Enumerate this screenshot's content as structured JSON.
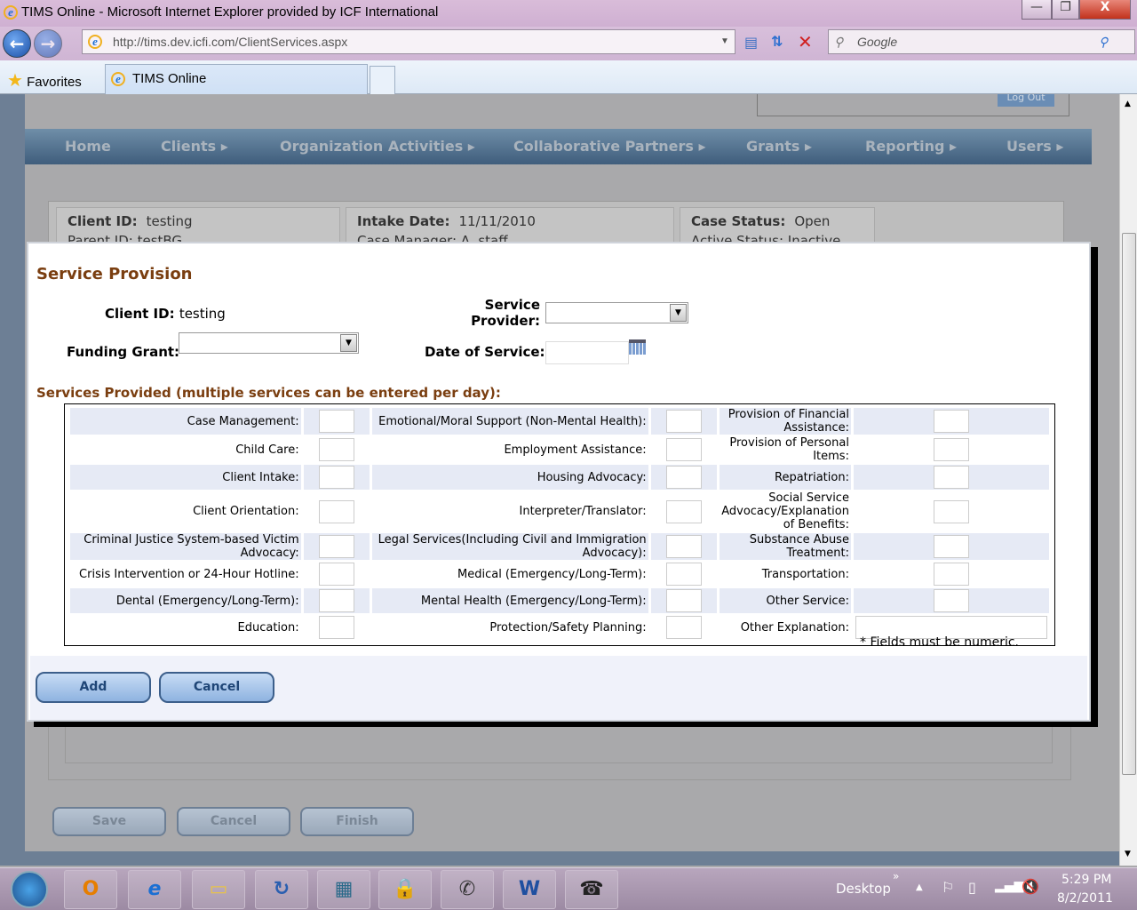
{
  "window": {
    "title": "TIMS Online - Microsoft Internet Explorer provided by ICF International",
    "min": "—",
    "restore": "❐",
    "close": "X"
  },
  "browser": {
    "url": "http://tims.dev.icfi.com/ClientServices.aspx",
    "search_placeholder": "Google",
    "favorites": "Favorites",
    "tab": "TIMS Online",
    "back": "←",
    "forward": "→"
  },
  "page": {
    "logout": "Log Out",
    "nav": [
      "Home",
      "Clients ▸",
      "Organization Activities ▸",
      "Collaborative Partners ▸",
      "Grants ▸",
      "Reporting ▸",
      "Users ▸"
    ],
    "info": {
      "client_id_label": "Client ID:",
      "client_id": "testing",
      "parent_id": "Parent ID: testBG",
      "intake_label": "Intake Date:",
      "intake": "11/11/2010",
      "case_manager": "Case Manager: A. staff",
      "case_status_label": "Case Status:",
      "case_status": "Open",
      "active_status": "Active Status: Inactive"
    },
    "buttons": {
      "save": "Save",
      "cancel": "Cancel",
      "finish": "Finish"
    }
  },
  "modal": {
    "title": "Service Provision",
    "client_id_label": "Client ID:",
    "client_id": "testing",
    "service_provider_label": "Service Provider:",
    "funding_grant_label": "Funding Grant:",
    "date_label": "Date of Service:",
    "services_heading": "Services Provided (multiple services can be entered per day):",
    "rows": [
      [
        "Case Management:",
        "Emotional/Moral Support (Non-Mental Health):",
        "Provision of Financial Assistance:"
      ],
      [
        "Child Care:",
        "Employment Assistance:",
        "Provision of Personal Items:"
      ],
      [
        "Client Intake:",
        "Housing Advocacy:",
        "Repatriation:"
      ],
      [
        "Client Orientation:",
        "Interpreter/Translator:",
        "Social Service Advocacy/Explanation of Benefits:"
      ],
      [
        "Criminal Justice System-based Victim Advocacy:",
        "Legal Services(Including Civil and Immigration Advocacy):",
        "Substance Abuse Treatment:"
      ],
      [
        "Crisis Intervention or 24-Hour Hotline:",
        "Medical (Emergency/Long-Term):",
        "Transportation:"
      ],
      [
        "Dental (Emergency/Long-Term):",
        "Mental Health (Emergency/Long-Term):",
        "Other Service:"
      ],
      [
        "Education:",
        "Protection/Safety Planning:",
        "Other Explanation:"
      ]
    ],
    "note": "* Fields must be numeric.",
    "add": "Add",
    "cancel": "Cancel"
  },
  "taskbar": {
    "desktop": "Desktop",
    "time": "5:29 PM",
    "date": "8/2/2011"
  }
}
